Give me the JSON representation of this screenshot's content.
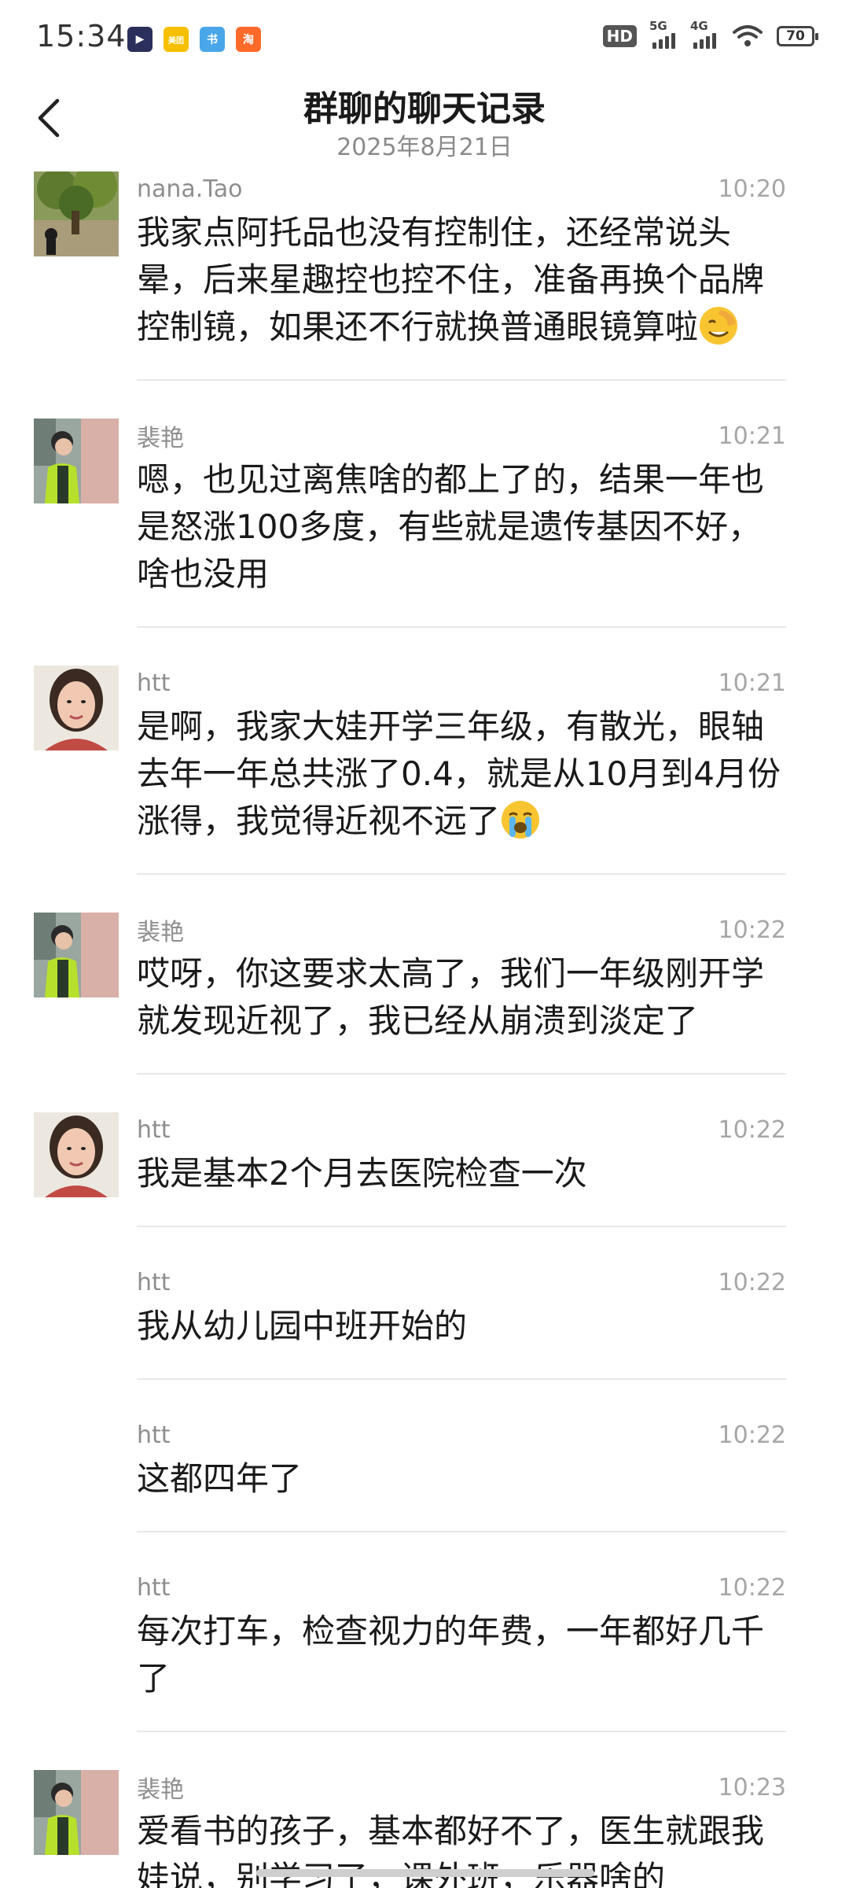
{
  "status_bar": {
    "time": "15:34",
    "battery": "70",
    "hd": "HD",
    "net1": "5G",
    "net2": "4G",
    "app_icons": [
      {
        "name": "video-app-icon",
        "color": "#2b2f5b",
        "glyph": "▶"
      },
      {
        "name": "meituan-app-icon",
        "color": "#f6c000",
        "glyph": "美团"
      },
      {
        "name": "book-app-icon",
        "color": "#49a6e9",
        "glyph": "书"
      },
      {
        "name": "taobao-app-icon",
        "color": "#ff6a2a",
        "glyph": "淘"
      }
    ]
  },
  "header": {
    "title": "群聊的聊天记录",
    "subtitle": "2025年8月21日"
  },
  "colors": {
    "divider": "#e8e8e8",
    "meta_text": "#8e8e8e",
    "body_text": "#1a1a1a"
  },
  "messages": [
    {
      "sender": "nana.Tao",
      "time": "10:20",
      "avatar": "tree-photo",
      "text": "我家点阿托品也没有控制住，还经常说头晕，后来星趣控也控不住，准备再换个品牌控制镜，如果还不行就换普通眼镜算啦",
      "emoji": "facepalm-emoji"
    },
    {
      "sender": "裴艳",
      "time": "10:21",
      "avatar": "child-photo",
      "text": "嗯，也见过离焦啥的都上了的，结果一年也是怒涨100多度，有些就是遗传基因不好，啥也没用"
    },
    {
      "sender": "htt",
      "time": "10:21",
      "avatar": "woman-photo",
      "text": "是啊，我家大娃开学三年级，有散光，眼轴去年一年总共涨了0.4，就是从10月到4月份涨得，我觉得近视不远了",
      "emoji": "crying-emoji"
    },
    {
      "sender": "裴艳",
      "time": "10:22",
      "avatar": "child-photo",
      "text": "哎呀，你这要求太高了，我们一年级刚开学就发现近视了，我已经从崩溃到淡定了"
    },
    {
      "sender": "htt",
      "time": "10:22",
      "avatar": "woman-photo",
      "text": "我是基本2个月去医院检查一次"
    },
    {
      "sender": "htt",
      "time": "10:22",
      "avatar": "",
      "text": "我从幼儿园中班开始的"
    },
    {
      "sender": "htt",
      "time": "10:22",
      "avatar": "",
      "text": "这都四年了"
    },
    {
      "sender": "htt",
      "time": "10:22",
      "avatar": "",
      "text": "每次打车，检查视力的年费，一年都好几千了"
    },
    {
      "sender": "裴艳",
      "time": "10:23",
      "avatar": "child-photo",
      "text": "爱看书的孩子，基本都好不了，医生就跟我娃说，别学习了，课外班，乐器啥的"
    }
  ]
}
